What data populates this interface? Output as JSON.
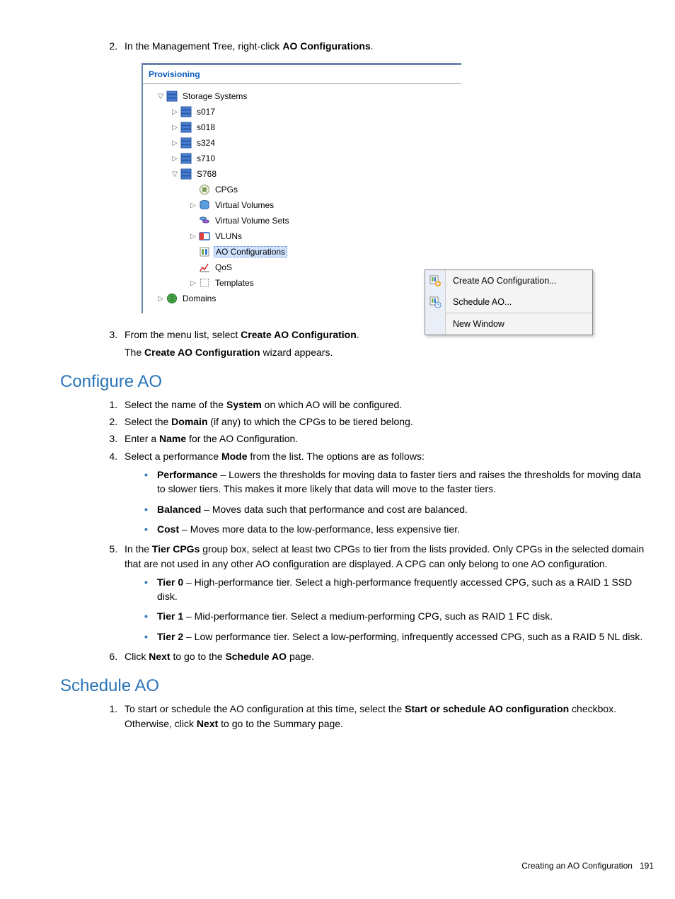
{
  "step2": {
    "pre": "In the Management Tree, right-click ",
    "bold": "AO Configurations",
    "post": "."
  },
  "panel_title": "Provisioning",
  "tree": {
    "root": "Storage Systems",
    "systems": [
      "s017",
      "s018",
      "s324",
      "s710",
      "S768"
    ],
    "children": [
      "CPGs",
      "Virtual Volumes",
      "Virtual Volume Sets",
      "VLUNs",
      "AO Configurations",
      "QoS",
      "Templates"
    ],
    "domains": "Domains"
  },
  "ctx_menu": {
    "item1": "Create AO Configuration...",
    "item2": "Schedule AO...",
    "item3": "New Window"
  },
  "step3": {
    "pre": "From the menu list, select ",
    "bold": "Create AO Configuration",
    "post": ".",
    "next_pre": "The ",
    "next_bold": "Create AO Configuration",
    "next_post": " wizard appears."
  },
  "hdr_configure": "Configure AO",
  "cfg": {
    "s1": {
      "pre": "Select the name of the ",
      "b": "System",
      "post": " on which AO will be configured."
    },
    "s2": {
      "pre": "Select the ",
      "b": "Domain",
      "post": " (if any) to which the CPGs to be tiered belong."
    },
    "s3": {
      "pre": "Enter a ",
      "b": "Name",
      "post": " for the AO Configuration."
    },
    "s4": {
      "pre": "Select a performance ",
      "b": "Mode",
      "post": " from the list. The options are as follows:"
    },
    "modes": {
      "perf": {
        "b": "Performance",
        "t": " – Lowers the thresholds for moving data to faster tiers and raises the thresholds for moving data to slower tiers. This makes it more likely that data will move to the faster tiers."
      },
      "bal": {
        "b": "Balanced",
        "t": " – Moves data such that performance and cost are balanced."
      },
      "cost": {
        "b": "Cost",
        "t": " – Moves more data to the low-performance, less expensive tier."
      }
    },
    "s5": {
      "pre": "In the ",
      "b": "Tier CPGs",
      "post": " group box, select at least two CPGs to tier from the lists provided. Only CPGs in the selected domain that are not used in any other AO configuration are displayed. A CPG can only belong to one AO configuration."
    },
    "tiers": {
      "t0": {
        "b": "Tier 0",
        "t": " – High-performance tier. Select a high-performance frequently accessed CPG, such as a RAID 1 SSD disk."
      },
      "t1": {
        "b": "Tier 1",
        "t": " – Mid-performance tier. Select a medium-performing CPG, such as RAID 1 FC disk."
      },
      "t2": {
        "b": "Tier 2",
        "t": " – Low performance tier. Select a low-performing, infrequently accessed CPG, such as a RAID 5 NL disk."
      }
    },
    "s6": {
      "pre": "Click ",
      "b1": "Next",
      "mid": " to go to the ",
      "b2": "Schedule AO",
      "post": " page."
    }
  },
  "hdr_schedule": "Schedule AO",
  "sch": {
    "s1": {
      "pre": "To start or schedule the AO configuration at this time, select the ",
      "b1": "Start or schedule AO configuration",
      "mid": " checkbox. Otherwise, click ",
      "b2": "Next",
      "post": " to go to the Summary page."
    }
  },
  "footer": {
    "title": "Creating an AO Configuration",
    "page": "191"
  }
}
